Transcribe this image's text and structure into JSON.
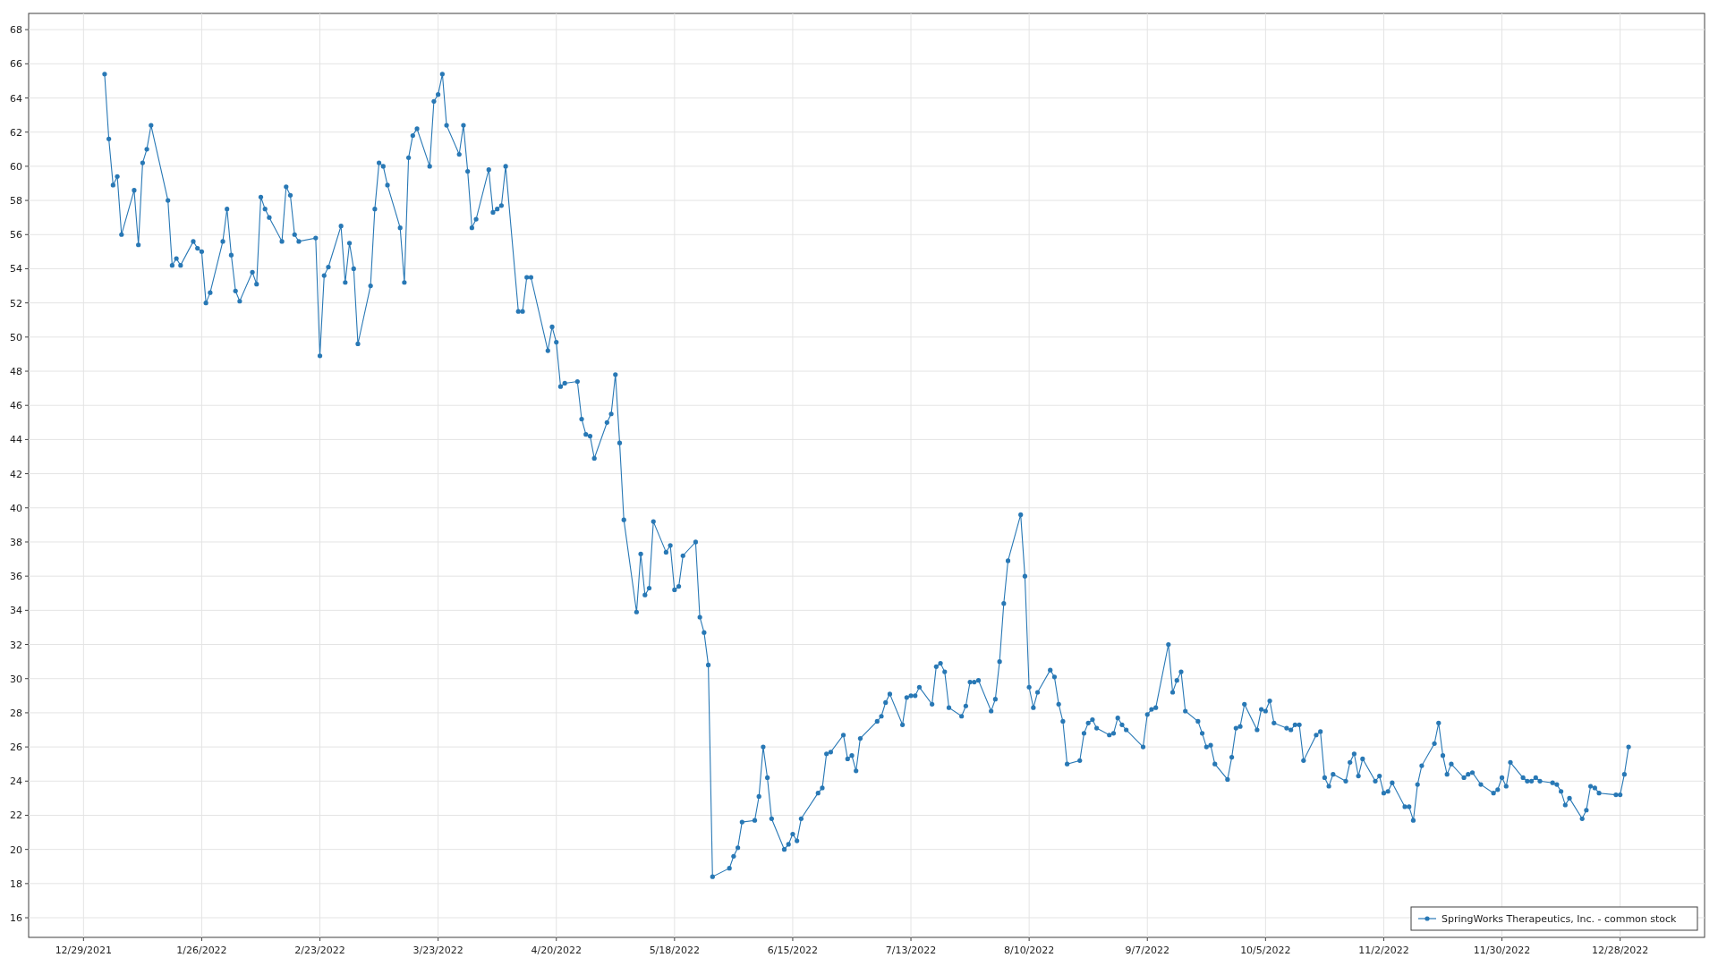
{
  "chart": {
    "chart_data": {
      "type": "line",
      "grid": true,
      "xlim": [
        "2021-12-16",
        "2023-01-17"
      ],
      "ylim": [
        14.85,
        68.95
      ],
      "xticks": [
        {
          "value": "2021-12-29",
          "label": "12/29/2021"
        },
        {
          "value": "2022-01-26",
          "label": "1/26/2022"
        },
        {
          "value": "2022-02-23",
          "label": "2/23/2022"
        },
        {
          "value": "2022-03-23",
          "label": "3/23/2022"
        },
        {
          "value": "2022-04-20",
          "label": "4/20/2022"
        },
        {
          "value": "2022-05-18",
          "label": "5/18/2022"
        },
        {
          "value": "2022-06-15",
          "label": "6/15/2022"
        },
        {
          "value": "2022-07-13",
          "label": "7/13/2022"
        },
        {
          "value": "2022-08-10",
          "label": "8/10/2022"
        },
        {
          "value": "2022-09-07",
          "label": "9/7/2022"
        },
        {
          "value": "2022-10-05",
          "label": "10/5/2022"
        },
        {
          "value": "2022-11-02",
          "label": "11/2/2022"
        },
        {
          "value": "2022-11-30",
          "label": "11/30/2022"
        },
        {
          "value": "2022-12-28",
          "label": "12/28/2022"
        }
      ],
      "yticks": [
        16,
        18,
        20,
        22,
        24,
        26,
        28,
        30,
        32,
        34,
        36,
        38,
        40,
        42,
        44,
        46,
        48,
        50,
        52,
        54,
        56,
        58,
        60,
        62,
        64,
        66,
        68
      ],
      "x": [
        "2022-01-03",
        "2022-01-04",
        "2022-01-05",
        "2022-01-06",
        "2022-01-07",
        "2022-01-10",
        "2022-01-11",
        "2022-01-12",
        "2022-01-13",
        "2022-01-14",
        "2022-01-18",
        "2022-01-19",
        "2022-01-20",
        "2022-01-21",
        "2022-01-24",
        "2022-01-25",
        "2022-01-26",
        "2022-01-27",
        "2022-01-28",
        "2022-01-31",
        "2022-02-01",
        "2022-02-02",
        "2022-02-03",
        "2022-02-04",
        "2022-02-07",
        "2022-02-08",
        "2022-02-09",
        "2022-02-10",
        "2022-02-11",
        "2022-02-14",
        "2022-02-15",
        "2022-02-16",
        "2022-02-17",
        "2022-02-18",
        "2022-02-22",
        "2022-02-23",
        "2022-02-24",
        "2022-02-25",
        "2022-02-28",
        "2022-03-01",
        "2022-03-02",
        "2022-03-03",
        "2022-03-04",
        "2022-03-07",
        "2022-03-08",
        "2022-03-09",
        "2022-03-10",
        "2022-03-11",
        "2022-03-14",
        "2022-03-15",
        "2022-03-16",
        "2022-03-17",
        "2022-03-18",
        "2022-03-21",
        "2022-03-22",
        "2022-03-23",
        "2022-03-24",
        "2022-03-25",
        "2022-03-28",
        "2022-03-29",
        "2022-03-30",
        "2022-03-31",
        "2022-04-01",
        "2022-04-04",
        "2022-04-05",
        "2022-04-06",
        "2022-04-07",
        "2022-04-08",
        "2022-04-11",
        "2022-04-12",
        "2022-04-13",
        "2022-04-14",
        "2022-04-18",
        "2022-04-19",
        "2022-04-20",
        "2022-04-21",
        "2022-04-22",
        "2022-04-25",
        "2022-04-26",
        "2022-04-27",
        "2022-04-28",
        "2022-04-29",
        "2022-05-02",
        "2022-05-03",
        "2022-05-04",
        "2022-05-05",
        "2022-05-06",
        "2022-05-09",
        "2022-05-10",
        "2022-05-11",
        "2022-05-12",
        "2022-05-13",
        "2022-05-16",
        "2022-05-17",
        "2022-05-18",
        "2022-05-19",
        "2022-05-20",
        "2022-05-23",
        "2022-05-24",
        "2022-05-25",
        "2022-05-26",
        "2022-05-27",
        "2022-05-31",
        "2022-06-01",
        "2022-06-02",
        "2022-06-03",
        "2022-06-06",
        "2022-06-07",
        "2022-06-08",
        "2022-06-09",
        "2022-06-10",
        "2022-06-13",
        "2022-06-14",
        "2022-06-15",
        "2022-06-16",
        "2022-06-17",
        "2022-06-21",
        "2022-06-22",
        "2022-06-23",
        "2022-06-24",
        "2022-06-27",
        "2022-06-28",
        "2022-06-29",
        "2022-06-30",
        "2022-07-01",
        "2022-07-05",
        "2022-07-06",
        "2022-07-07",
        "2022-07-08",
        "2022-07-11",
        "2022-07-12",
        "2022-07-13",
        "2022-07-14",
        "2022-07-15",
        "2022-07-18",
        "2022-07-19",
        "2022-07-20",
        "2022-07-21",
        "2022-07-22",
        "2022-07-25",
        "2022-07-26",
        "2022-07-27",
        "2022-07-28",
        "2022-07-29",
        "2022-08-01",
        "2022-08-02",
        "2022-08-03",
        "2022-08-04",
        "2022-08-05",
        "2022-08-08",
        "2022-08-09",
        "2022-08-10",
        "2022-08-11",
        "2022-08-12",
        "2022-08-15",
        "2022-08-16",
        "2022-08-17",
        "2022-08-18",
        "2022-08-19",
        "2022-08-22",
        "2022-08-23",
        "2022-08-24",
        "2022-08-25",
        "2022-08-26",
        "2022-08-29",
        "2022-08-30",
        "2022-08-31",
        "2022-09-01",
        "2022-09-02",
        "2022-09-06",
        "2022-09-07",
        "2022-09-08",
        "2022-09-09",
        "2022-09-12",
        "2022-09-13",
        "2022-09-14",
        "2022-09-15",
        "2022-09-16",
        "2022-09-19",
        "2022-09-20",
        "2022-09-21",
        "2022-09-22",
        "2022-09-23",
        "2022-09-26",
        "2022-09-27",
        "2022-09-28",
        "2022-09-29",
        "2022-09-30",
        "2022-10-03",
        "2022-10-04",
        "2022-10-05",
        "2022-10-06",
        "2022-10-07",
        "2022-10-10",
        "2022-10-11",
        "2022-10-12",
        "2022-10-13",
        "2022-10-14",
        "2022-10-17",
        "2022-10-18",
        "2022-10-19",
        "2022-10-20",
        "2022-10-21",
        "2022-10-24",
        "2022-10-25",
        "2022-10-26",
        "2022-10-27",
        "2022-10-28",
        "2022-10-31",
        "2022-11-01",
        "2022-11-02",
        "2022-11-03",
        "2022-11-04",
        "2022-11-07",
        "2022-11-08",
        "2022-11-09",
        "2022-11-10",
        "2022-11-11",
        "2022-11-14",
        "2022-11-15",
        "2022-11-16",
        "2022-11-17",
        "2022-11-18",
        "2022-11-21",
        "2022-11-22",
        "2022-11-23",
        "2022-11-25",
        "2022-11-28",
        "2022-11-29",
        "2022-11-30",
        "2022-12-01",
        "2022-12-02",
        "2022-12-05",
        "2022-12-06",
        "2022-12-07",
        "2022-12-08",
        "2022-12-09",
        "2022-12-12",
        "2022-12-13",
        "2022-12-14",
        "2022-12-15",
        "2022-12-16",
        "2022-12-19",
        "2022-12-20",
        "2022-12-21",
        "2022-12-22",
        "2022-12-23",
        "2022-12-27",
        "2022-12-28",
        "2022-12-29",
        "2022-12-30"
      ],
      "series": [
        {
          "name": "SpringWorks Therapeutics, Inc. - common stock",
          "color": "#2878b5",
          "values": [
            65.4,
            61.6,
            58.9,
            59.4,
            56.0,
            58.6,
            55.4,
            60.2,
            61.0,
            62.4,
            58.0,
            54.2,
            54.6,
            54.2,
            55.6,
            55.2,
            55.0,
            52.0,
            52.6,
            55.6,
            57.5,
            54.8,
            52.7,
            52.1,
            53.8,
            53.1,
            58.2,
            57.5,
            57.0,
            55.6,
            58.8,
            58.3,
            56.0,
            55.6,
            55.8,
            48.9,
            53.6,
            54.1,
            56.5,
            53.2,
            55.5,
            54.0,
            49.6,
            53.0,
            57.5,
            60.2,
            60.0,
            58.9,
            56.4,
            53.2,
            60.5,
            61.8,
            62.2,
            60.0,
            63.8,
            64.2,
            65.4,
            62.4,
            60.7,
            62.4,
            59.7,
            56.4,
            56.9,
            59.8,
            57.3,
            57.5,
            57.7,
            60.0,
            51.5,
            51.5,
            53.5,
            53.5,
            49.2,
            50.6,
            49.7,
            47.1,
            47.3,
            47.4,
            45.2,
            44.3,
            44.2,
            42.9,
            45.0,
            45.5,
            47.8,
            43.8,
            39.3,
            33.9,
            37.3,
            34.9,
            35.3,
            39.2,
            37.4,
            37.8,
            35.2,
            35.4,
            37.2,
            38.0,
            33.6,
            32.7,
            30.8,
            18.4,
            18.9,
            19.6,
            20.1,
            21.6,
            21.7,
            23.1,
            26.0,
            24.2,
            21.8,
            20.0,
            20.3,
            20.9,
            20.5,
            21.8,
            23.3,
            23.6,
            25.6,
            25.7,
            26.7,
            25.3,
            25.5,
            24.6,
            26.5,
            27.5,
            27.8,
            28.6,
            29.1,
            27.3,
            28.9,
            29.0,
            29.0,
            29.5,
            28.5,
            30.7,
            30.9,
            30.4,
            28.3,
            27.8,
            28.4,
            29.8,
            29.8,
            29.9,
            28.1,
            28.8,
            31.0,
            34.4,
            36.9,
            39.6,
            36.0,
            29.5,
            28.3,
            29.2,
            30.5,
            30.1,
            28.5,
            27.5,
            25.0,
            25.2,
            26.8,
            27.4,
            27.6,
            27.1,
            26.7,
            26.8,
            27.7,
            27.3,
            27.0,
            26.0,
            27.9,
            28.2,
            28.3,
            32.0,
            29.2,
            29.9,
            30.4,
            28.1,
            27.5,
            26.8,
            26.0,
            26.1,
            25.0,
            24.1,
            25.4,
            27.1,
            27.2,
            28.5,
            27.0,
            28.2,
            28.1,
            28.7,
            27.4,
            27.1,
            27.0,
            27.3,
            27.3,
            25.2,
            26.7,
            26.9,
            24.2,
            23.7,
            24.4,
            24.0,
            25.1,
            25.6,
            24.3,
            25.3,
            24.0,
            24.3,
            23.3,
            23.4,
            23.9,
            22.5,
            22.5,
            21.7,
            23.8,
            24.9,
            26.2,
            27.4,
            25.5,
            24.4,
            25.0,
            24.2,
            24.4,
            24.5,
            23.8,
            23.3,
            23.5,
            24.2,
            23.7,
            25.1,
            24.2,
            24.0,
            24.0,
            24.2,
            24.0,
            23.9,
            23.8,
            23.4,
            22.6,
            23.0,
            21.8,
            22.3,
            23.7,
            23.6,
            23.3,
            23.2,
            23.2,
            24.4,
            26.0
          ]
        }
      ]
    }
  }
}
